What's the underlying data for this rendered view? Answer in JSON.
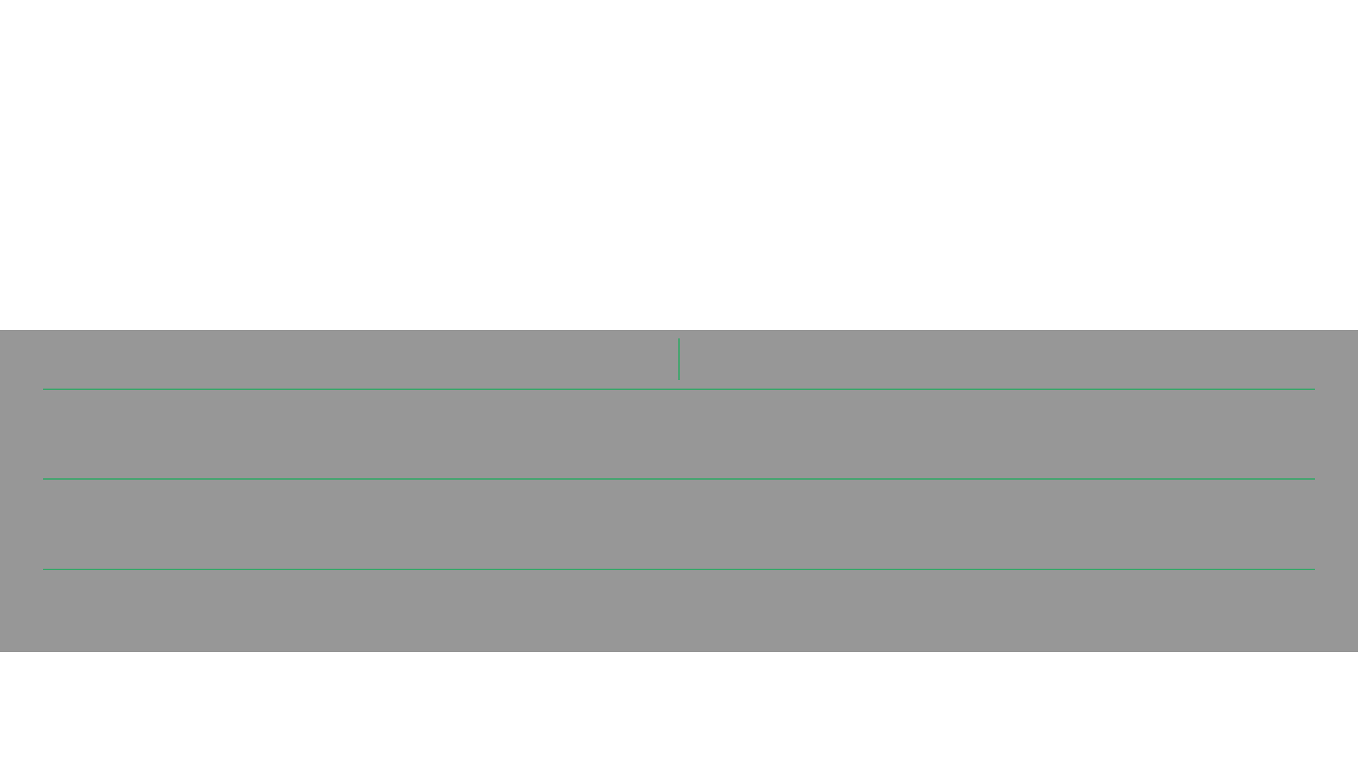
{
  "colors": {
    "page_background": "#ffffff",
    "band_background": "#979797",
    "line_accent": "#3aa66a"
  },
  "band": {
    "marker_icon": "vertical-bar",
    "rule_count": 3
  }
}
